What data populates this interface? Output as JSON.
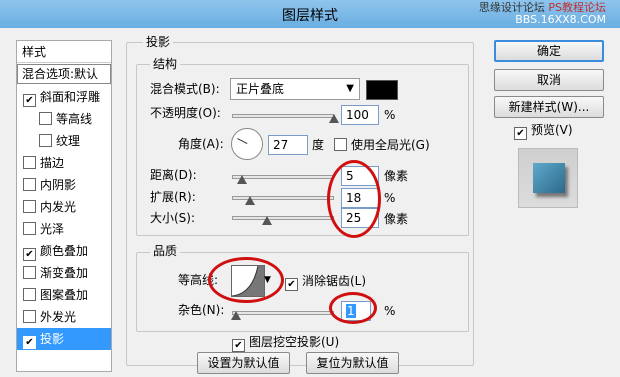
{
  "window": {
    "title": "图层样式",
    "watermark_line1": "思缘设计论坛",
    "watermark_line2": "PS教程论坛",
    "watermark_line3": "BBS.16XX8.COM"
  },
  "left": {
    "header": "样式",
    "blend_options": "混合选项:默认",
    "items": [
      {
        "label": "斜面和浮雕",
        "checked": true
      },
      {
        "label": "等高线",
        "checked": false
      },
      {
        "label": "纹理",
        "checked": false
      },
      {
        "label": "描边",
        "checked": false
      },
      {
        "label": "内阴影",
        "checked": false
      },
      {
        "label": "内发光",
        "checked": false
      },
      {
        "label": "光泽",
        "checked": false
      },
      {
        "label": "颜色叠加",
        "checked": true
      },
      {
        "label": "渐变叠加",
        "checked": false
      },
      {
        "label": "图案叠加",
        "checked": false
      },
      {
        "label": "外发光",
        "checked": false
      },
      {
        "label": "投影",
        "checked": true
      }
    ]
  },
  "main": {
    "section_title": "投影",
    "structure": {
      "title": "结构",
      "blend_mode_label": "混合模式(B):",
      "blend_mode_value": "正片叠底",
      "blend_color": "#000000",
      "opacity_label": "不透明度(O):",
      "opacity_value": "100",
      "opacity_unit": "%",
      "angle_label": "角度(A):",
      "angle_value": "27",
      "angle_unit": "度",
      "global_light_label": "使用全局光(G)",
      "global_light_checked": false,
      "distance_label": "距离(D):",
      "distance_value": "5",
      "distance_unit": "像素",
      "spread_label": "扩展(R):",
      "spread_value": "18",
      "spread_unit": "%",
      "size_label": "大小(S):",
      "size_value": "25",
      "size_unit": "像素"
    },
    "quality": {
      "title": "品质",
      "contour_label": "等高线:",
      "anti_alias_label": "消除锯齿(L)",
      "anti_alias_checked": true,
      "noise_label": "杂色(N):",
      "noise_value": "1",
      "noise_unit": "%"
    },
    "knockout_label": "图层挖空投影(U)",
    "knockout_checked": true,
    "set_default_label": "设置为默认值",
    "reset_default_label": "复位为默认值"
  },
  "right": {
    "ok_label": "确定",
    "cancel_label": "取消",
    "new_style_label": "新建样式(W)...",
    "preview_label": "预览(V)",
    "preview_checked": true
  }
}
